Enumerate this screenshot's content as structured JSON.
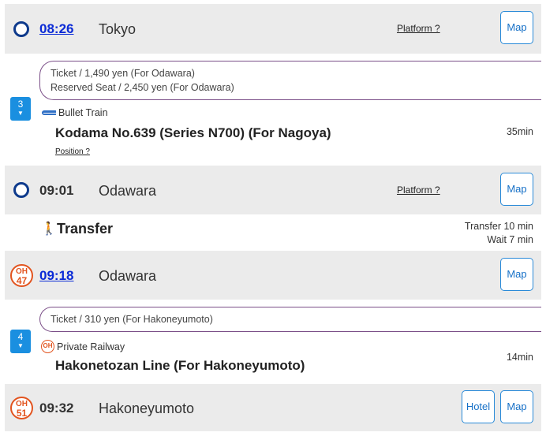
{
  "stations": [
    {
      "time": "08:26",
      "name": "Tokyo",
      "platform": "Platform ?",
      "map": "Map"
    },
    {
      "time": "09:01",
      "name": "Odawara",
      "platform": "Platform ?",
      "map": "Map"
    },
    {
      "time": "09:18",
      "name": "Odawara",
      "badge_line": "OH",
      "badge_num": "47",
      "map": "Map"
    },
    {
      "time": "09:32",
      "name": "Hakoneyumoto",
      "badge_line": "OH",
      "badge_num": "51",
      "hotel": "Hotel",
      "map": "Map"
    }
  ],
  "segments": [
    {
      "fare_lines": [
        "Ticket / 1,490 yen (For Odawara)",
        "Reserved Seat / 2,450 yen (For Odawara)"
      ],
      "car": "3",
      "service_type": "Bullet Train",
      "line_name": "Kodama No.639 (Series N700) (For Nagoya)",
      "duration": "35min",
      "position_link": "Position ?",
      "line_color": "#1f5fb3"
    },
    {
      "fare_lines": [
        "Ticket / 310 yen (For Hakoneyumoto)"
      ],
      "car": "4",
      "service_icon": "OH",
      "service_type": "Private Railway",
      "line_name": "Hakonetozan Line (For Hakoneyumoto)",
      "duration": "14min",
      "line_color": "#f5a21b"
    }
  ],
  "transfer": {
    "label": "Transfer",
    "transfer_time": "Transfer 10 min",
    "wait_time": "Wait 7 min"
  },
  "colors": {
    "link": "#0b2bd6",
    "button_border": "#2a8ad8",
    "oh_badge": "#e2541f",
    "car_badge": "#1a8fe0"
  }
}
